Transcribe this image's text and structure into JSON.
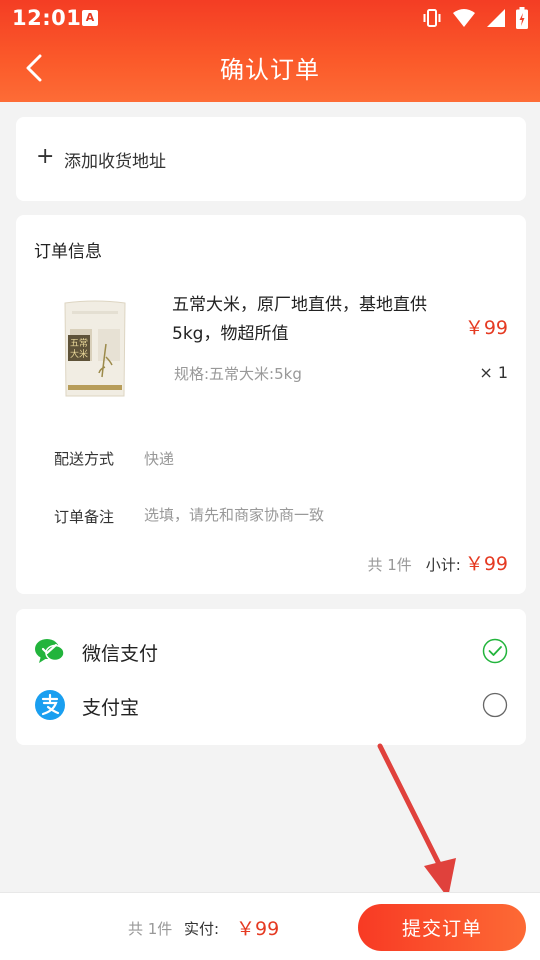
{
  "status_bar": {
    "time": "12:01",
    "notification_glyph": "A",
    "icons": [
      "vibrate-icon",
      "wifi-icon",
      "signal-icon",
      "battery-icon"
    ]
  },
  "header": {
    "title": "确认订单",
    "back_icon": "chevron-left-icon"
  },
  "address": {
    "plus": "+",
    "label": "添加收货地址"
  },
  "order": {
    "section_title": "订单信息",
    "product": {
      "name": "五常大米，原厂地直供，基地直供5kg，物超所值",
      "price": "￥99",
      "spec": "规格:五常大米:5kg",
      "quantity": "× 1",
      "image_text": "五常大米"
    },
    "shipping": {
      "label": "配送方式",
      "value": "快递"
    },
    "note": {
      "label": "订单备注",
      "placeholder": "选填，请先和商家协商一致"
    },
    "summary": {
      "count": "共 1件",
      "subtotal_label": "小计:",
      "subtotal": "￥99"
    }
  },
  "payment": {
    "methods": [
      {
        "label": "微信支付",
        "icon": "wechat-pay-icon",
        "selected": true
      },
      {
        "label": "支付宝",
        "icon": "alipay-icon",
        "selected": false
      }
    ]
  },
  "footer": {
    "count": "共 1件",
    "paid_label": "实付:",
    "amount": "￥99",
    "submit": "提交订单"
  },
  "colors": {
    "accent": "#e53a22",
    "header_gradient_start": "#f43d24",
    "header_gradient_end": "#fd6c36",
    "wechat_green": "#22b43c",
    "alipay_blue": "#1a9ff0",
    "annotation_arrow": "#e0413c"
  }
}
